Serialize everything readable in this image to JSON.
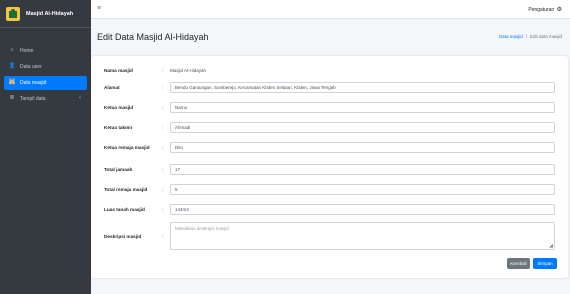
{
  "brand": {
    "name": "Masjid Al-Hidayah"
  },
  "sidebar": {
    "items": [
      {
        "label": "Home",
        "icon": "home-icon",
        "glyph": "⌂"
      },
      {
        "label": "Data user",
        "icon": "user-icon",
        "glyph": "👤"
      },
      {
        "label": "Data masjid",
        "icon": "mosque-icon",
        "glyph": "🕌"
      },
      {
        "label": "Tampil data",
        "icon": "database-icon",
        "glyph": "≣"
      }
    ],
    "expand_glyph": "‹"
  },
  "topbar": {
    "menu_glyph": "≡",
    "settings_label": "Pengaturan",
    "settings_glyph": "⚙"
  },
  "header": {
    "title": "Edit Data Masjid Al-Hidayah",
    "breadcrumb": {
      "link": "Data masjid",
      "separator": "/",
      "current": "Edit data masjid"
    }
  },
  "form": {
    "fields": [
      {
        "label": "Nama masjid",
        "value": "Masjid Al-Hidayah"
      },
      {
        "label": "Alamat",
        "value": "Bendo Gantungan, Sumberejo, Kecamatan Klaten Selatan, Klaten, Jawa Tengah"
      },
      {
        "label": "Ketua masjid",
        "value": "Narno"
      },
      {
        "label": "Ketua takmir",
        "value": "Ahmadi"
      },
      {
        "label": "Ketua remaja masjid",
        "value": "Dito"
      },
      {
        "label": "Total jamaah",
        "value": "17"
      },
      {
        "label": "Total remaja masjid",
        "value": "5"
      },
      {
        "label": "Luas tanah masjid",
        "value": "144m2"
      },
      {
        "label": "Deskripsi masjid",
        "value": "",
        "placeholder": "Masukkan deskripsi masjid"
      }
    ],
    "colon": ":",
    "resize_glyph": "◢",
    "buttons": {
      "back": "Kembali",
      "save": "Simpan"
    }
  },
  "colors": {
    "sidebar": "#343a40",
    "accent": "#007bff",
    "secondary": "#6c757d"
  }
}
